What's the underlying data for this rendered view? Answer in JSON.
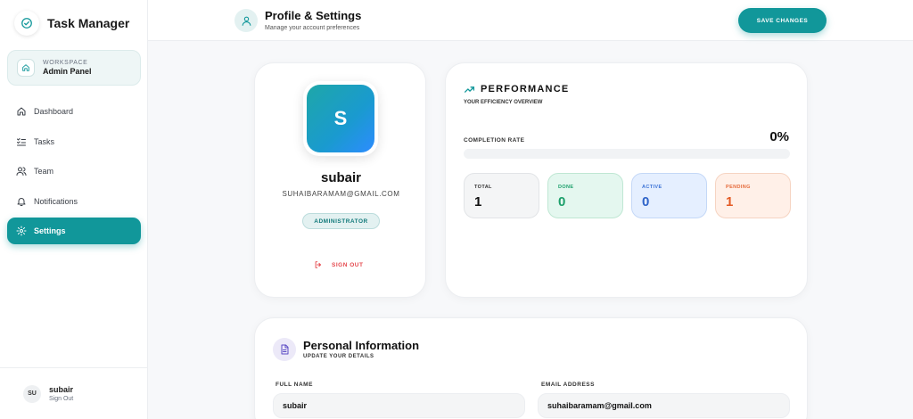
{
  "app": {
    "title": "Task Manager"
  },
  "workspace": {
    "label": "WORKSPACE",
    "name": "Admin Panel"
  },
  "nav": {
    "items": [
      {
        "label": "Dashboard",
        "icon": "home-icon"
      },
      {
        "label": "Tasks",
        "icon": "list-icon"
      },
      {
        "label": "Team",
        "icon": "users-icon"
      },
      {
        "label": "Notifications",
        "icon": "bell-icon"
      },
      {
        "label": "Settings",
        "icon": "gear-icon",
        "active": true
      }
    ]
  },
  "user_footer": {
    "initials": "SU",
    "name": "subair",
    "action": "Sign Out"
  },
  "header": {
    "title": "Profile & Settings",
    "subtitle": "Manage your account preferences",
    "save_label": "SAVE CHANGES"
  },
  "profile": {
    "initial": "S",
    "name": "subair",
    "email": "SUHAIBARAMAM@GMAIL.COM",
    "role": "ADMINISTRATOR",
    "signout_label": "SIGN OUT"
  },
  "performance": {
    "title": "PERFORMANCE",
    "subtitle": "YOUR EFFICIENCY OVERVIEW",
    "completion_label": "COMPLETION RATE",
    "completion_value": "0%",
    "completion_fraction": 0,
    "stats": {
      "total": {
        "label": "TOTAL",
        "value": "1"
      },
      "done": {
        "label": "DONE",
        "value": "0"
      },
      "active": {
        "label": "ACTIVE",
        "value": "0"
      },
      "pending": {
        "label": "PENDING",
        "value": "1"
      }
    }
  },
  "personal_info": {
    "title": "Personal Information",
    "subtitle": "UPDATE YOUR DETAILS",
    "full_name_label": "FULL NAME",
    "full_name_value": "subair",
    "email_label": "EMAIL ADDRESS",
    "email_value": "suhaibaramam@gmail.com"
  },
  "colors": {
    "accent": "#11979a",
    "done": "#1b9f6a",
    "active": "#2f64c9",
    "pending": "#e45a24",
    "danger": "#e5484d"
  }
}
